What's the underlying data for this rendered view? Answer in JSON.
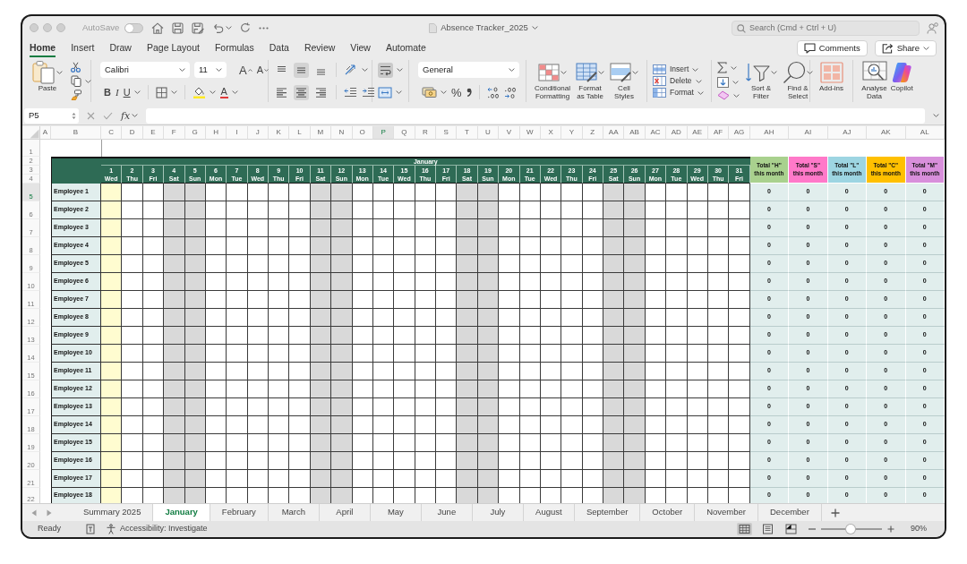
{
  "window": {
    "title": "Absence Tracker_2025"
  },
  "title_bar": {
    "autosave": {
      "label": "AutoSave",
      "on": false
    },
    "search": {
      "placeholder": "Search (Cmd + Ctrl + U)"
    }
  },
  "ribbon_tabs": [
    {
      "label": "Home",
      "selected": true
    },
    {
      "label": "Insert",
      "selected": false
    },
    {
      "label": "Draw",
      "selected": false
    },
    {
      "label": "Page Layout",
      "selected": false
    },
    {
      "label": "Formulas",
      "selected": false
    },
    {
      "label": "Data",
      "selected": false
    },
    {
      "label": "Review",
      "selected": false
    },
    {
      "label": "View",
      "selected": false
    },
    {
      "label": "Automate",
      "selected": false
    }
  ],
  "ribbon_actions": {
    "comments": "Comments",
    "share": "Share"
  },
  "ribbon": {
    "paste": "Paste",
    "font_name": "Calibri",
    "font_size": "11",
    "grow_font": "A",
    "shrink_font": "A",
    "bold": "B",
    "italic": "I",
    "underline": "U",
    "font_color": "A",
    "alignment": [
      {
        "kind": "top",
        "on": false
      },
      {
        "kind": "middle",
        "on": true
      },
      {
        "kind": "bottom",
        "on": false
      },
      {
        "kind": "left",
        "on": false
      },
      {
        "kind": "center",
        "on": true
      },
      {
        "kind": "right",
        "on": false
      }
    ],
    "wrap_text": {
      "on": true
    },
    "number_format": "General",
    "percent": "%",
    "styles": [
      "Conditional\nFormatting",
      "Format\nas Table",
      "Cell\nStyles"
    ],
    "cells": [
      "Insert",
      "Delete",
      "Format"
    ],
    "editing": [
      "Sort &\nFilter",
      "Find &\nSelect"
    ],
    "add_ins": "Add-ins",
    "analysis": [
      "Analyse\nData",
      "Copilot"
    ]
  },
  "formula_bar": {
    "name_box": "P5",
    "function_label": "fx"
  },
  "sheet": {
    "column_headers": [
      {
        "label": "A",
        "selected": false
      },
      {
        "label": "B",
        "selected": false
      },
      {
        "label": "C",
        "selected": false
      },
      {
        "label": "D",
        "selected": false
      },
      {
        "label": "E",
        "selected": false
      },
      {
        "label": "F",
        "selected": false
      },
      {
        "label": "G",
        "selected": false
      },
      {
        "label": "H",
        "selected": false
      },
      {
        "label": "I",
        "selected": false
      },
      {
        "label": "J",
        "selected": false
      },
      {
        "label": "K",
        "selected": false
      },
      {
        "label": "L",
        "selected": false
      },
      {
        "label": "M",
        "selected": false
      },
      {
        "label": "N",
        "selected": false
      },
      {
        "label": "O",
        "selected": false
      },
      {
        "label": "P",
        "selected": true
      },
      {
        "label": "Q",
        "selected": false
      },
      {
        "label": "R",
        "selected": false
      },
      {
        "label": "S",
        "selected": false
      },
      {
        "label": "T",
        "selected": false
      },
      {
        "label": "U",
        "selected": false
      },
      {
        "label": "V",
        "selected": false
      },
      {
        "label": "W",
        "selected": false
      },
      {
        "label": "X",
        "selected": false
      },
      {
        "label": "Y",
        "selected": false
      },
      {
        "label": "Z",
        "selected": false
      },
      {
        "label": "AA",
        "selected": false
      },
      {
        "label": "AB",
        "selected": false
      },
      {
        "label": "AC",
        "selected": false
      },
      {
        "label": "AD",
        "selected": false
      },
      {
        "label": "AE",
        "selected": false
      },
      {
        "label": "AF",
        "selected": false
      },
      {
        "label": "AG",
        "selected": false
      },
      {
        "label": "AH",
        "selected": false
      },
      {
        "label": "AI",
        "selected": false
      },
      {
        "label": "AJ",
        "selected": false
      },
      {
        "label": "AK",
        "selected": false
      },
      {
        "label": "AL",
        "selected": false
      }
    ],
    "row_headers": [
      {
        "label": "1",
        "selected": false
      },
      {
        "label": "2",
        "selected": false
      },
      {
        "label": "3",
        "selected": false
      },
      {
        "label": "4",
        "selected": false
      },
      {
        "label": "5",
        "selected": true
      },
      {
        "label": "6",
        "selected": false
      },
      {
        "label": "7",
        "selected": false
      },
      {
        "label": "8",
        "selected": false
      },
      {
        "label": "9",
        "selected": false
      },
      {
        "label": "10",
        "selected": false
      },
      {
        "label": "11",
        "selected": false
      },
      {
        "label": "12",
        "selected": false
      },
      {
        "label": "13",
        "selected": false
      },
      {
        "label": "14",
        "selected": false
      },
      {
        "label": "15",
        "selected": false
      },
      {
        "label": "16",
        "selected": false
      },
      {
        "label": "17",
        "selected": false
      },
      {
        "label": "18",
        "selected": false
      },
      {
        "label": "19",
        "selected": false
      },
      {
        "label": "20",
        "selected": false
      },
      {
        "label": "21",
        "selected": false
      },
      {
        "label": "22",
        "selected": false
      }
    ],
    "month": "January",
    "days": [
      {
        "day": "1",
        "weekday": "Wed",
        "kind": "holiday"
      },
      {
        "day": "2",
        "weekday": "Thu",
        "kind": "weekday"
      },
      {
        "day": "3",
        "weekday": "Fri",
        "kind": "weekday"
      },
      {
        "day": "4",
        "weekday": "Sat",
        "kind": "weekend"
      },
      {
        "day": "5",
        "weekday": "Sun",
        "kind": "weekend"
      },
      {
        "day": "6",
        "weekday": "Mon",
        "kind": "weekday"
      },
      {
        "day": "7",
        "weekday": "Tue",
        "kind": "weekday"
      },
      {
        "day": "8",
        "weekday": "Wed",
        "kind": "weekday"
      },
      {
        "day": "9",
        "weekday": "Thu",
        "kind": "weekday"
      },
      {
        "day": "10",
        "weekday": "Fri",
        "kind": "weekday"
      },
      {
        "day": "11",
        "weekday": "Sat",
        "kind": "weekend"
      },
      {
        "day": "12",
        "weekday": "Sun",
        "kind": "weekend"
      },
      {
        "day": "13",
        "weekday": "Mon",
        "kind": "weekday"
      },
      {
        "day": "14",
        "weekday": "Tue",
        "kind": "weekday"
      },
      {
        "day": "15",
        "weekday": "Wed",
        "kind": "weekday"
      },
      {
        "day": "16",
        "weekday": "Thu",
        "kind": "weekday"
      },
      {
        "day": "17",
        "weekday": "Fri",
        "kind": "weekday"
      },
      {
        "day": "18",
        "weekday": "Sat",
        "kind": "weekend"
      },
      {
        "day": "19",
        "weekday": "Sun",
        "kind": "weekend"
      },
      {
        "day": "20",
        "weekday": "Mon",
        "kind": "weekday"
      },
      {
        "day": "21",
        "weekday": "Tue",
        "kind": "weekday"
      },
      {
        "day": "22",
        "weekday": "Wed",
        "kind": "weekday"
      },
      {
        "day": "23",
        "weekday": "Thu",
        "kind": "weekday"
      },
      {
        "day": "24",
        "weekday": "Fri",
        "kind": "weekday"
      },
      {
        "day": "25",
        "weekday": "Sat",
        "kind": "weekend"
      },
      {
        "day": "26",
        "weekday": "Sun",
        "kind": "weekend"
      },
      {
        "day": "27",
        "weekday": "Mon",
        "kind": "weekday"
      },
      {
        "day": "28",
        "weekday": "Tue",
        "kind": "weekday"
      },
      {
        "day": "29",
        "weekday": "Wed",
        "kind": "weekday"
      },
      {
        "day": "30",
        "weekday": "Thu",
        "kind": "weekday"
      },
      {
        "day": "31",
        "weekday": "Fri",
        "kind": "weekday"
      }
    ],
    "totals": [
      {
        "label": "Total \"H\"\nthis month",
        "color": "#a9d18e"
      },
      {
        "label": "Total \"S\"\nthis month",
        "color": "#ff79c9"
      },
      {
        "label": "Total \"L\"\nthis month",
        "color": "#9dd5e2"
      },
      {
        "label": "Total \"C\"\nthis month",
        "color": "#ffc000"
      },
      {
        "label": "Total \"M\"\nthis month",
        "color": "#d88fdb"
      }
    ],
    "employees": [
      {
        "name": "Employee 1",
        "totals": [
          "0",
          "0",
          "0",
          "0",
          "0"
        ]
      },
      {
        "name": "Employee 2",
        "totals": [
          "0",
          "0",
          "0",
          "0",
          "0"
        ]
      },
      {
        "name": "Employee 3",
        "totals": [
          "0",
          "0",
          "0",
          "0",
          "0"
        ]
      },
      {
        "name": "Employee 4",
        "totals": [
          "0",
          "0",
          "0",
          "0",
          "0"
        ]
      },
      {
        "name": "Employee 5",
        "totals": [
          "0",
          "0",
          "0",
          "0",
          "0"
        ]
      },
      {
        "name": "Employee 6",
        "totals": [
          "0",
          "0",
          "0",
          "0",
          "0"
        ]
      },
      {
        "name": "Employee 7",
        "totals": [
          "0",
          "0",
          "0",
          "0",
          "0"
        ]
      },
      {
        "name": "Employee 8",
        "totals": [
          "0",
          "0",
          "0",
          "0",
          "0"
        ]
      },
      {
        "name": "Employee 9",
        "totals": [
          "0",
          "0",
          "0",
          "0",
          "0"
        ]
      },
      {
        "name": "Employee 10",
        "totals": [
          "0",
          "0",
          "0",
          "0",
          "0"
        ]
      },
      {
        "name": "Employee 11",
        "totals": [
          "0",
          "0",
          "0",
          "0",
          "0"
        ]
      },
      {
        "name": "Employee 12",
        "totals": [
          "0",
          "0",
          "0",
          "0",
          "0"
        ]
      },
      {
        "name": "Employee 13",
        "totals": [
          "0",
          "0",
          "0",
          "0",
          "0"
        ]
      },
      {
        "name": "Employee 14",
        "totals": [
          "0",
          "0",
          "0",
          "0",
          "0"
        ]
      },
      {
        "name": "Employee 15",
        "totals": [
          "0",
          "0",
          "0",
          "0",
          "0"
        ]
      },
      {
        "name": "Employee 16",
        "totals": [
          "0",
          "0",
          "0",
          "0",
          "0"
        ]
      },
      {
        "name": "Employee 17",
        "totals": [
          "0",
          "0",
          "0",
          "0",
          "0"
        ]
      },
      {
        "name": "Employee 18",
        "totals": [
          "0",
          "0",
          "0",
          "0",
          "0"
        ]
      }
    ]
  },
  "sheet_tabs": [
    {
      "label": "Summary 2025",
      "selected": false
    },
    {
      "label": "January",
      "selected": true
    },
    {
      "label": "February",
      "selected": false
    },
    {
      "label": "March",
      "selected": false
    },
    {
      "label": "April",
      "selected": false
    },
    {
      "label": "May",
      "selected": false
    },
    {
      "label": "June",
      "selected": false
    },
    {
      "label": "July",
      "selected": false
    },
    {
      "label": "August",
      "selected": false
    },
    {
      "label": "September",
      "selected": false
    },
    {
      "label": "October",
      "selected": false
    },
    {
      "label": "November",
      "selected": false
    },
    {
      "label": "December",
      "selected": false
    }
  ],
  "status_bar": {
    "status": "Ready",
    "accessibility": "Accessibility: Investigate",
    "views": [
      {
        "kind": "normal",
        "selected": true
      },
      {
        "kind": "page_layout",
        "selected": false
      },
      {
        "kind": "page_break",
        "selected": false
      }
    ],
    "zoom": {
      "level": 0.48,
      "reading": "90%"
    }
  }
}
